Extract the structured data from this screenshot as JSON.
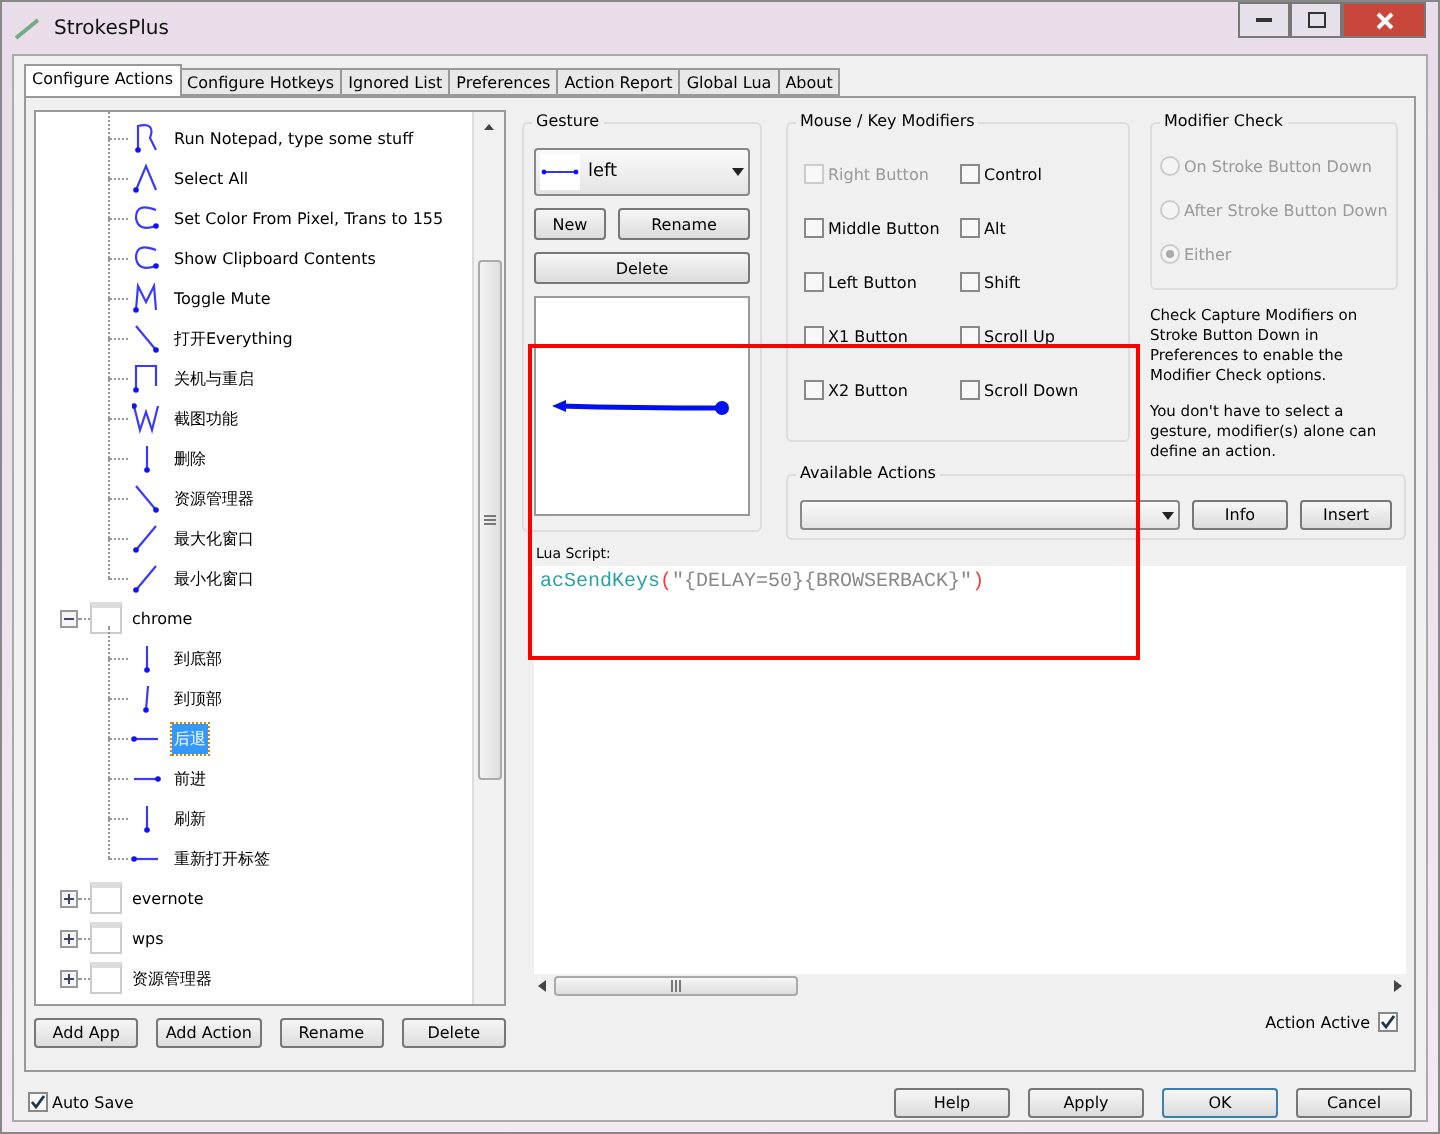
{
  "window": {
    "title": "StrokesPlus"
  },
  "tabs": [
    {
      "label": "Configure Actions",
      "selected": true
    },
    {
      "label": "Configure Hotkeys",
      "selected": false
    },
    {
      "label": "Ignored List",
      "selected": false
    },
    {
      "label": "Preferences",
      "selected": false
    },
    {
      "label": "Action Report",
      "selected": false
    },
    {
      "label": "Global Lua",
      "selected": false
    },
    {
      "label": "About",
      "selected": false
    }
  ],
  "tree": {
    "groups": [
      {
        "expanded": true,
        "children": [
          {
            "label": "Run Notepad, type some stuff",
            "selected": false
          },
          {
            "label": "Select All",
            "selected": false
          },
          {
            "label": "Set Color From Pixel, Trans to 155",
            "selected": false
          },
          {
            "label": "Show Clipboard Contents",
            "selected": false
          },
          {
            "label": "Toggle Mute",
            "selected": false
          },
          {
            "label": "打开Everything",
            "selected": false
          },
          {
            "label": "关机与重启",
            "selected": false
          },
          {
            "label": "截图功能",
            "selected": false
          },
          {
            "label": "删除",
            "selected": false
          },
          {
            "label": "资源管理器",
            "selected": false
          },
          {
            "label": "最大化窗口",
            "selected": false
          },
          {
            "label": "最小化窗口",
            "selected": false
          }
        ]
      },
      {
        "name": "chrome",
        "expanded": true,
        "children": [
          {
            "label": "到底部",
            "selected": false
          },
          {
            "label": "到顶部",
            "selected": false
          },
          {
            "label": "后退",
            "selected": true
          },
          {
            "label": "前进",
            "selected": false
          },
          {
            "label": "刷新",
            "selected": false
          },
          {
            "label": "重新打开标签",
            "selected": false
          }
        ]
      },
      {
        "name": "evernote",
        "expanded": false
      },
      {
        "name": "wps",
        "expanded": false
      },
      {
        "name": "资源管理器",
        "expanded": false
      }
    ]
  },
  "tree_buttons": [
    "Add App",
    "Add Action",
    "Rename",
    "Delete"
  ],
  "gesture": {
    "title": "Gesture",
    "selected_gesture": "left",
    "buttons": [
      "New",
      "Rename",
      "Delete"
    ]
  },
  "modifiers": {
    "title": "Mouse / Key Modifiers",
    "items": [
      {
        "label": "Right Button",
        "checked": false,
        "disabled": true
      },
      {
        "label": "Control",
        "checked": false,
        "disabled": false
      },
      {
        "label": "Middle Button",
        "checked": false,
        "disabled": false
      },
      {
        "label": "Alt",
        "checked": false,
        "disabled": false
      },
      {
        "label": "Left Button",
        "checked": false,
        "disabled": false
      },
      {
        "label": "Shift",
        "checked": false,
        "disabled": false
      },
      {
        "label": "X1 Button",
        "checked": false,
        "disabled": false
      },
      {
        "label": "Scroll Up",
        "checked": false,
        "disabled": false
      },
      {
        "label": "X2 Button",
        "checked": false,
        "disabled": false
      },
      {
        "label": "Scroll Down",
        "checked": false,
        "disabled": false
      }
    ]
  },
  "modifier_check": {
    "title": "Modifier Check",
    "options": [
      {
        "label": "On Stroke Button Down",
        "selected": false
      },
      {
        "label": "After Stroke Button Down",
        "selected": false
      },
      {
        "label": "Either",
        "selected": true
      }
    ],
    "disabled": true
  },
  "notes": [
    "Check Capture Modifiers on Stroke Button Down in Preferences to enable the Modifier Check options.",
    "You don't have to select a gesture, modifier(s) alone can define an action."
  ],
  "available_actions": {
    "title": "Available Actions",
    "buttons": [
      "Info",
      "Insert"
    ]
  },
  "lua": {
    "label": "Lua Script:",
    "code": [
      {
        "kind": "function",
        "text": "acSendKeys"
      },
      {
        "kind": "paren",
        "text": "("
      },
      {
        "kind": "string",
        "text": "\"{DELAY=50}{BROWSERBACK}\""
      },
      {
        "kind": "paren",
        "text": ")"
      }
    ]
  },
  "action_active": {
    "label": "Action Active",
    "checked": true
  },
  "auto_save": {
    "label": "Auto Save",
    "checked": true
  },
  "dialog_buttons": [
    {
      "label": "Help",
      "default": false
    },
    {
      "label": "Apply",
      "default": false
    },
    {
      "label": "OK",
      "default": true
    },
    {
      "label": "Cancel",
      "default": false
    }
  ]
}
